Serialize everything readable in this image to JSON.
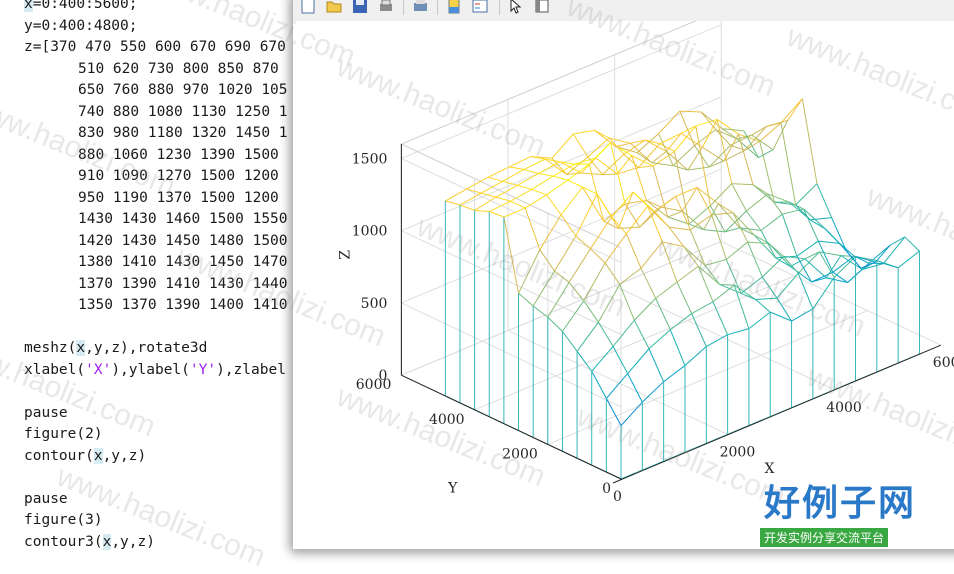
{
  "editor": {
    "lines": [
      {
        "pre": "",
        "var": "x",
        "post": "=0:400:5600;"
      },
      {
        "pre": "",
        "var": "",
        "post": "y=0:400:4800;"
      },
      {
        "pre": "",
        "var": "",
        "post": "z=[370 470 550 600 670 690 670"
      },
      {
        "pre": "",
        "var": "",
        "post": "510 620 730 800 850 870"
      },
      {
        "pre": "",
        "var": "",
        "post": "650 760 880 970 1020 105"
      },
      {
        "pre": "",
        "var": "",
        "post": "740 880 1080 1130 1250 1"
      },
      {
        "pre": "",
        "var": "",
        "post": "830 980 1180 1320 1450 1"
      },
      {
        "pre": "",
        "var": "",
        "post": "880 1060 1230 1390 1500"
      },
      {
        "pre": "",
        "var": "",
        "post": "910 1090 1270 1500 1200"
      },
      {
        "pre": "",
        "var": "",
        "post": "950 1190 1370 1500 1200"
      },
      {
        "pre": "",
        "var": "",
        "post": "1430 1430 1460 1500 1550"
      },
      {
        "pre": "",
        "var": "",
        "post": "1420 1430 1450 1480 1500"
      },
      {
        "pre": "",
        "var": "",
        "post": "1380 1410 1430 1450 1470"
      },
      {
        "pre": "",
        "var": "",
        "post": "1370 1390 1410 1430 1440"
      },
      {
        "pre": "",
        "var": "",
        "post": "1350 1370 1390 1400 1410"
      },
      {
        "pre": "",
        "var": "",
        "post": ""
      },
      {
        "pre": "meshz(",
        "var": "x",
        "post": ",y,z),rotate3d"
      },
      {
        "pre": "xlabel(",
        "str1": "'X'",
        "mid": "),ylabel(",
        "str2": "'Y'",
        "post2": "),zlabel"
      },
      {
        "pre": "",
        "var": "",
        "post": ""
      },
      {
        "pre": "",
        "var": "",
        "post": "pause"
      },
      {
        "pre": "",
        "var": "",
        "post": "figure(2)"
      },
      {
        "pre": "contour(",
        "var": "x",
        "post": ",y,z)"
      },
      {
        "pre": "",
        "var": "",
        "post": ""
      },
      {
        "pre": "",
        "var": "",
        "post": "pause"
      },
      {
        "pre": "",
        "var": "",
        "post": "figure(3)"
      },
      {
        "pre": "contour3(",
        "var": "x",
        "post": ",y,z)"
      }
    ]
  },
  "toolbar": {
    "icons": [
      "new-figure-icon",
      "open-file-icon",
      "save-icon",
      "print-icon",
      "print-preview-icon",
      "insert-colorbar-icon",
      "insert-legend-icon",
      "pointer-icon",
      "property-editor-icon"
    ]
  },
  "chart_data": {
    "type": "surface",
    "plot": "meshz",
    "xlabel": "X",
    "ylabel": "Y",
    "zlabel": "Z",
    "x": [
      0,
      400,
      800,
      1200,
      1600,
      2000,
      2400,
      2800,
      3200,
      3600,
      4000,
      4400,
      4800,
      5200,
      5600
    ],
    "y": [
      0,
      400,
      800,
      1200,
      1600,
      2000,
      2400,
      2800,
      3200,
      3600,
      4000,
      4400,
      4800
    ],
    "xlim": [
      0,
      6000
    ],
    "ylim": [
      0,
      6000
    ],
    "zlim": [
      0,
      1600
    ],
    "xticks": [
      "0",
      "2000",
      "4000",
      "6000"
    ],
    "yticks": [
      "0",
      "2000",
      "4000",
      "6000"
    ],
    "zticks": [
      "0",
      "500",
      "1000",
      "1500"
    ],
    "colormap": "parula",
    "grid": true,
    "z_rows_visible": [
      [
        370,
        470,
        550,
        600,
        670,
        690,
        670
      ],
      [
        510,
        620,
        730,
        800,
        850,
        870
      ],
      [
        650,
        760,
        880,
        970,
        1020
      ],
      [
        740,
        880,
        1080,
        1130,
        1250
      ],
      [
        830,
        980,
        1180,
        1320,
        1450
      ],
      [
        880,
        1060,
        1230,
        1390,
        1500
      ],
      [
        910,
        1090,
        1270,
        1500,
        1200
      ],
      [
        950,
        1190,
        1370,
        1500,
        1200
      ],
      [
        1430,
        1430,
        1460,
        1500,
        1550
      ],
      [
        1420,
        1430,
        1450,
        1480,
        1500
      ],
      [
        1380,
        1410,
        1430,
        1450,
        1470
      ],
      [
        1370,
        1390,
        1410,
        1430,
        1440
      ],
      [
        1350,
        1370,
        1390,
        1400,
        1410
      ]
    ]
  },
  "watermark": {
    "text": "www.haolizi.com",
    "logo_title": "好例子网",
    "logo_subtitle": "开发实例分享交流平台"
  }
}
